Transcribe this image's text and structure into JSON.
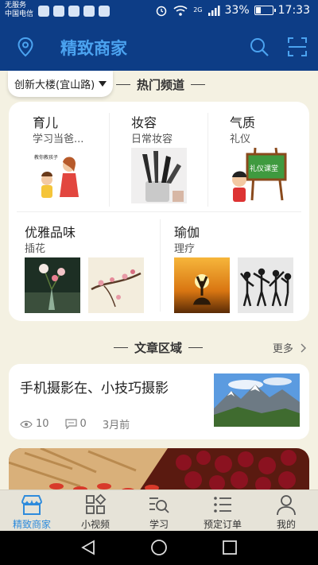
{
  "status_bar": {
    "carrier_line1": "无服务",
    "carrier_line2": "中国电信",
    "network": "2G",
    "battery_text": "33%",
    "battery_level": 0.33,
    "time": "17:33"
  },
  "header": {
    "title": "精致商家"
  },
  "location": {
    "label": "创新大楼(宜山路)"
  },
  "hot_channels": {
    "title": "热门频道",
    "items": [
      {
        "title": "育儿",
        "subtitle": "学习当爸..."
      },
      {
        "title": "妆容",
        "subtitle": "日常妆容"
      },
      {
        "title": "气质",
        "subtitle": "礼仪"
      },
      {
        "title": "优雅品味",
        "subtitle": "插花"
      },
      {
        "title": "瑜伽",
        "subtitle": "理疗"
      }
    ],
    "image_texts": {
      "parenting": "教你教孩子",
      "etiquette": "礼仪课堂"
    }
  },
  "articles": {
    "title": "文章区域",
    "more_label": "更多",
    "items": [
      {
        "title": "手机摄影在、小技巧摄影",
        "views": "10",
        "comments": "0",
        "time": "3月前"
      }
    ]
  },
  "tabbar": {
    "tabs": [
      {
        "label": "精致商家",
        "icon": "shop-icon",
        "active": true
      },
      {
        "label": "小视频",
        "icon": "grid-icon",
        "active": false
      },
      {
        "label": "学习",
        "icon": "study-icon",
        "active": false
      },
      {
        "label": "预定订单",
        "icon": "list-icon",
        "active": false
      },
      {
        "label": "我的",
        "icon": "person-icon",
        "active": false
      }
    ]
  },
  "colors": {
    "header_bg": "#0d3d86",
    "title_blue": "#4ba3f0",
    "page_bg": "#f4f1e2",
    "tab_active": "#2e8bdc"
  }
}
